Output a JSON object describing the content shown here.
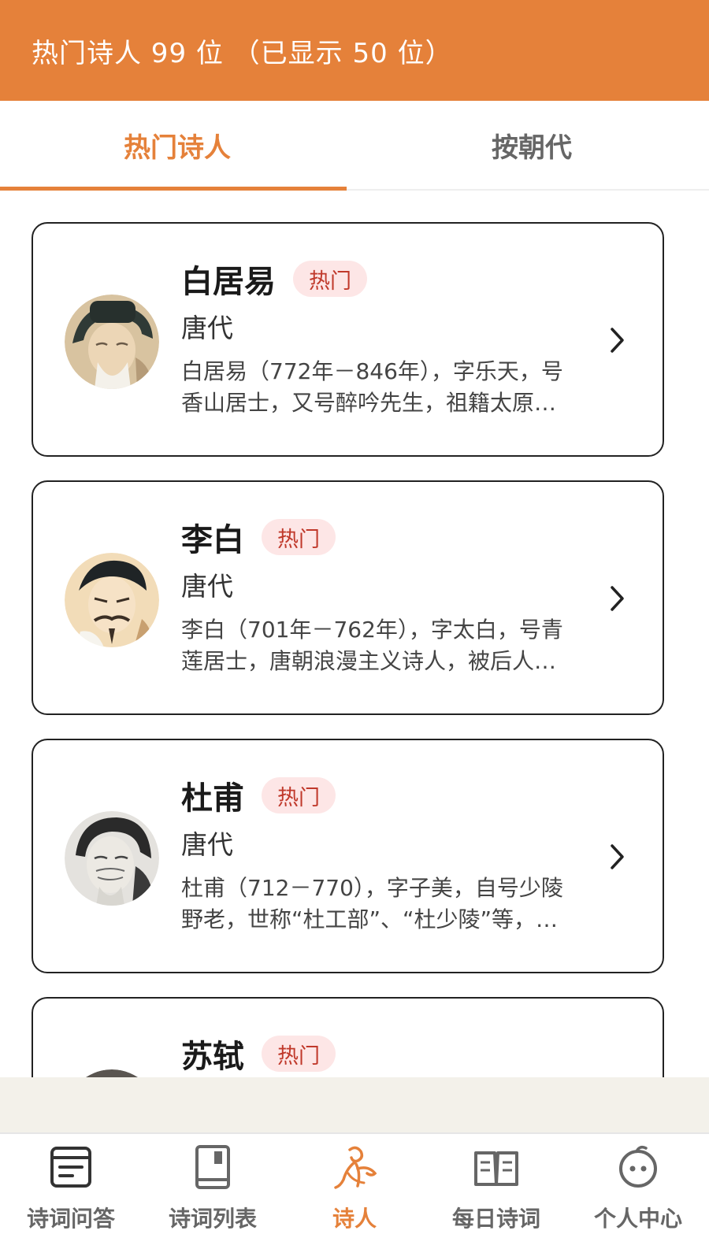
{
  "header": {
    "title": "热门诗人 99 位  （已显示 50 位）"
  },
  "tabs": [
    {
      "label": "热门诗人",
      "active": true
    },
    {
      "label": "按朝代",
      "active": false
    }
  ],
  "poets": [
    {
      "name": "白居易",
      "badge": "热门",
      "dynasty": "唐代",
      "desc": "白居易（772年－846年），字乐天，号香山居士，又号醉吟先生，祖籍太原…"
    },
    {
      "name": "李白",
      "badge": "热门",
      "dynasty": "唐代",
      "desc": "李白（701年－762年），字太白，号青莲居士，唐朝浪漫主义诗人，被后人…"
    },
    {
      "name": "杜甫",
      "badge": "热门",
      "dynasty": "唐代",
      "desc": "杜甫（712－770），字子美，自号少陵野老，世称“杜工部”、“杜少陵”等，…"
    },
    {
      "name": "苏轼",
      "badge": "热门",
      "dynasty": "",
      "desc": ""
    }
  ],
  "bottom_nav": [
    {
      "label": "诗词问答",
      "icon": "qa-card-icon",
      "active": false
    },
    {
      "label": "诗词列表",
      "icon": "book-icon",
      "active": false
    },
    {
      "label": "诗人",
      "icon": "poet-figure-icon",
      "active": true
    },
    {
      "label": "每日诗词",
      "icon": "open-book-icon",
      "active": false
    },
    {
      "label": "个人中心",
      "icon": "smiley-face-icon",
      "active": false
    }
  ],
  "colors": {
    "accent": "#e5813a",
    "badge_bg": "#fde6e6",
    "badge_text": "#c0392b",
    "nav_inactive": "#666666"
  }
}
